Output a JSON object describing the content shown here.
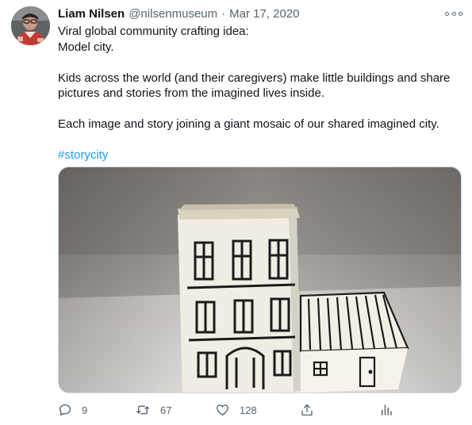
{
  "tweet": {
    "author": {
      "name": "Liam Nilsen",
      "handle": "@nilsenmuseum",
      "separator": "·",
      "date": "Mar 17, 2020"
    },
    "text": {
      "line1": "Viral global community crafting idea:",
      "line2": "Model city.",
      "para2_line1": "Kids across the world (and their caregivers) make little buildings and share",
      "para2_line2": "pictures and stories from the imagined lives inside.",
      "para3": "Each image and story joining a giant mosaic of our shared imagined city.",
      "hashtag": "#storycity"
    },
    "media": {
      "alt": "Photo of two small paper model buildings with hand-drawn windows and doors"
    },
    "actions": {
      "replies": "9",
      "retweets": "67",
      "likes": "128"
    },
    "icons": {
      "reply": "reply-icon",
      "retweet": "retweet-icon",
      "like": "heart-icon",
      "share": "share-icon",
      "analytics": "analytics-icon",
      "more": "more-icon"
    },
    "colors": {
      "link": "#1d9bf0",
      "secondary_text": "#536471",
      "primary_text": "#0f1419"
    }
  }
}
